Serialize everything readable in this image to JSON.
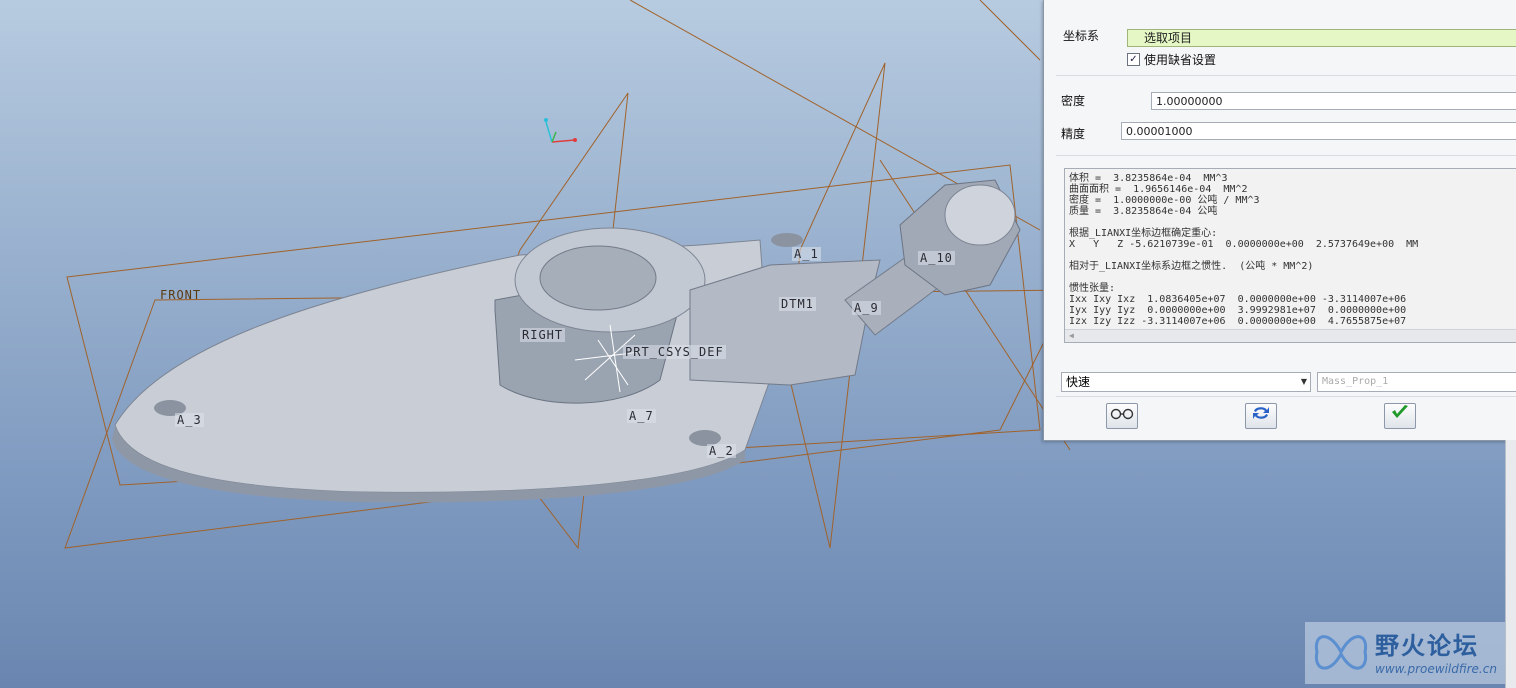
{
  "viewport": {
    "datum_labels": {
      "front": "FRONT",
      "right": "RIGHT",
      "prt_csys": "PRT_CSYS_DEF",
      "dtm1": "DTM1",
      "a1": "A_1",
      "a2": "A_2",
      "a3": "A_3",
      "a7": "A_7",
      "a9": "A_9",
      "a10": "A_10"
    }
  },
  "dialog": {
    "csys_label": "坐标系",
    "csys_select": "选取项目",
    "use_default_label": "使用缺省设置",
    "use_default_checked": true,
    "density_label": "密度",
    "density_value": "1.00000000",
    "accuracy_label": "精度",
    "accuracy_value": "0.00001000",
    "results": {
      "volume": "体积 =  3.8235864e-04  MM^3",
      "surface_area": "曲面面积 =  1.9656146e-04  MM^2",
      "density": "密度 =  1.0000000e-00 公吨 / MM^3",
      "mass": "质量 =  3.8235864e-04 公吨",
      "cg_title": "根据_LIANXI坐标边框确定重心:",
      "cg_values": "X   Y   Z -5.6210739e-01  0.0000000e+00  2.5737649e+00  MM",
      "inertia_title": "相对于_LIANXI坐标系边框之惯性.  (公吨 * MM^2)",
      "tensor_title": "惯性张量:",
      "tensor_row1": "Ixx Ixy Ixz  1.0836405e+07  0.0000000e+00 -3.3114007e+06",
      "tensor_row2": "Iyx Iyy Iyz  0.0000000e+00  3.9992981e+07  0.0000000e+00",
      "tensor_row3": "Izx Izy Izz -3.3114007e+06  0.0000000e+00  4.7655875e+07"
    },
    "mode_select": "快速",
    "name_field": "Mass_Prop_1"
  },
  "watermark": {
    "title": "野火论坛",
    "url": "www.proewildfire.cn"
  },
  "colors": {
    "datum_plane": "#a0622a",
    "confirm_green": "#1f9a2a",
    "csys_select_bg": "#e4f7c4"
  },
  "icons": {
    "preview": "glasses-icon",
    "regenerate": "refresh-icon",
    "confirm": "checkmark-icon"
  }
}
